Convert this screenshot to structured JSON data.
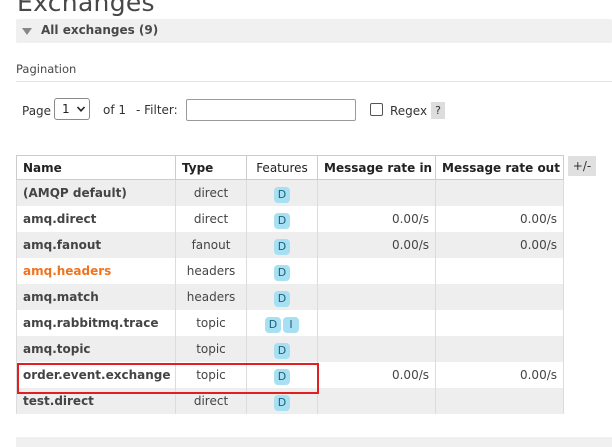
{
  "page": {
    "title": "Exchanges"
  },
  "section": {
    "label": "All exchanges (9)"
  },
  "pagination": {
    "label": "Pagination",
    "page_label": "Page",
    "page_value": "1",
    "of_label": "of 1",
    "filter_label": "- Filter:",
    "filter_value": "",
    "regex_label": "Regex",
    "help_label": "?"
  },
  "table": {
    "headers": {
      "name": "Name",
      "type": "Type",
      "features": "Features",
      "rate_in": "Message rate in",
      "rate_out": "Message rate out"
    },
    "columns_toggle": "+/-",
    "rows": [
      {
        "name": "(AMQP default)",
        "type": "direct",
        "features": [
          "D"
        ],
        "rate_in": "",
        "rate_out": ""
      },
      {
        "name": "amq.direct",
        "type": "direct",
        "features": [
          "D"
        ],
        "rate_in": "0.00/s",
        "rate_out": "0.00/s"
      },
      {
        "name": "amq.fanout",
        "type": "fanout",
        "features": [
          "D"
        ],
        "rate_in": "0.00/s",
        "rate_out": "0.00/s"
      },
      {
        "name": "amq.headers",
        "type": "headers",
        "features": [
          "D"
        ],
        "rate_in": "",
        "rate_out": ""
      },
      {
        "name": "amq.match",
        "type": "headers",
        "features": [
          "D"
        ],
        "rate_in": "",
        "rate_out": ""
      },
      {
        "name": "amq.rabbitmq.trace",
        "type": "topic",
        "features": [
          "D",
          "I"
        ],
        "rate_in": "",
        "rate_out": ""
      },
      {
        "name": "amq.topic",
        "type": "topic",
        "features": [
          "D"
        ],
        "rate_in": "",
        "rate_out": ""
      },
      {
        "name": "order.event.exchange",
        "type": "topic",
        "features": [
          "D"
        ],
        "rate_in": "0.00/s",
        "rate_out": "0.00/s"
      },
      {
        "name": "test.direct",
        "type": "direct",
        "features": [
          "D"
        ],
        "rate_in": "",
        "rate_out": ""
      }
    ]
  },
  "colors": {
    "hovered_link": "#f0731e",
    "badge_bg": "#a8e0f3",
    "highlight_border": "#e02020",
    "stripe": "#eeeeee"
  },
  "icons": {
    "collapse": "triangle-down-icon",
    "select": "chevron-down-icon"
  }
}
